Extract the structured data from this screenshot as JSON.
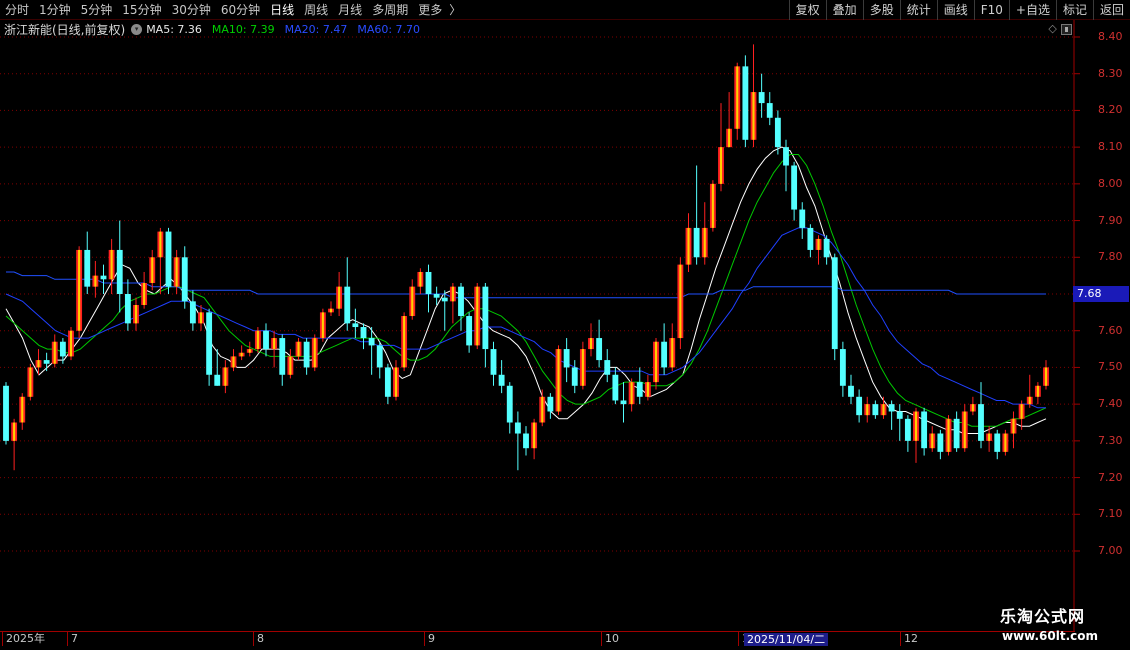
{
  "toolbar": {
    "periods": [
      "分时",
      "1分钟",
      "5分钟",
      "15分钟",
      "30分钟",
      "60分钟",
      "日线",
      "周线",
      "月线",
      "多周期",
      "更多"
    ],
    "more_arrow": "〉",
    "buttons": [
      "复权",
      "叠加",
      "多股",
      "统计",
      "画线",
      "F10",
      "+自选",
      "标记",
      "返回"
    ]
  },
  "info": {
    "stock_name": "浙江新能(日线,前复权)",
    "circle_glyph": "▾",
    "ma5": "MA5: 7.36",
    "ma10": "MA10: 7.39",
    "ma20": "MA20: 7.47",
    "ma60": "MA60: 7.70",
    "right_icons": [
      "◇",
      "⇔"
    ]
  },
  "price_axis": {
    "ticks": [
      "8.40",
      "8.30",
      "8.20",
      "8.10",
      "8.00",
      "7.90",
      "7.80",
      "7.70",
      "7.60",
      "7.50",
      "7.40",
      "7.30",
      "7.20",
      "7.10",
      "7.00"
    ],
    "cursor_price": "7.68"
  },
  "date_axis": {
    "ticks": [
      "2025年",
      "7",
      "8",
      "9",
      "10",
      "1",
      "12"
    ],
    "cursor_date": "2025/11/04/二"
  },
  "watermark": {
    "title": "乐淘公式网",
    "url": "www.60lt.com"
  },
  "colors": {
    "up_candle": "#ff2020",
    "up_candle_inner": "#ffd000",
    "down_candle": "#54ffff",
    "ma5": "#ffffff",
    "ma10": "#00c800",
    "ma20": "#2040ff",
    "ma60": "#2050ff",
    "grid": "#800000",
    "axis_text": "#d03030"
  },
  "chart_data": {
    "type": "candlestick",
    "y_range": [
      7.0,
      8.4
    ],
    "ohlc": [
      [
        7.45,
        7.3,
        7.46,
        7.29
      ],
      [
        7.3,
        7.35,
        7.36,
        7.22
      ],
      [
        7.35,
        7.42,
        7.43,
        7.33
      ],
      [
        7.42,
        7.5,
        7.51,
        7.41
      ],
      [
        7.5,
        7.52,
        7.55,
        7.48
      ],
      [
        7.52,
        7.51,
        7.54,
        7.49
      ],
      [
        7.51,
        7.57,
        7.59,
        7.5
      ],
      [
        7.57,
        7.53,
        7.58,
        7.51
      ],
      [
        7.53,
        7.6,
        7.61,
        7.52
      ],
      [
        7.6,
        7.82,
        7.83,
        7.58
      ],
      [
        7.82,
        7.72,
        7.87,
        7.7
      ],
      [
        7.72,
        7.75,
        7.79,
        7.69
      ],
      [
        7.75,
        7.74,
        7.78,
        7.7
      ],
      [
        7.74,
        7.82,
        7.85,
        7.7
      ],
      [
        7.82,
        7.7,
        7.9,
        7.65
      ],
      [
        7.7,
        7.62,
        7.74,
        7.6
      ],
      [
        7.62,
        7.67,
        7.69,
        7.6
      ],
      [
        7.67,
        7.73,
        7.76,
        7.66
      ],
      [
        7.73,
        7.8,
        7.82,
        7.71
      ],
      [
        7.8,
        7.87,
        7.88,
        7.7
      ],
      [
        7.87,
        7.72,
        7.88,
        7.7
      ],
      [
        7.72,
        7.8,
        7.82,
        7.7
      ],
      [
        7.8,
        7.68,
        7.83,
        7.66
      ],
      [
        7.68,
        7.62,
        7.71,
        7.6
      ],
      [
        7.62,
        7.65,
        7.67,
        7.6
      ],
      [
        7.65,
        7.48,
        7.66,
        7.45
      ],
      [
        7.48,
        7.45,
        7.55,
        7.45
      ],
      [
        7.45,
        7.5,
        7.52,
        7.43
      ],
      [
        7.5,
        7.53,
        7.55,
        7.49
      ],
      [
        7.53,
        7.54,
        7.56,
        7.52
      ],
      [
        7.54,
        7.55,
        7.57,
        7.53
      ],
      [
        7.55,
        7.6,
        7.61,
        7.54
      ],
      [
        7.6,
        7.55,
        7.62,
        7.53
      ],
      [
        7.55,
        7.58,
        7.6,
        7.5
      ],
      [
        7.58,
        7.48,
        7.59,
        7.45
      ],
      [
        7.48,
        7.53,
        7.55,
        7.47
      ],
      [
        7.53,
        7.57,
        7.58,
        7.52
      ],
      [
        7.57,
        7.5,
        7.58,
        7.48
      ],
      [
        7.5,
        7.58,
        7.59,
        7.49
      ],
      [
        7.58,
        7.65,
        7.66,
        7.57
      ],
      [
        7.65,
        7.66,
        7.68,
        7.64
      ],
      [
        7.66,
        7.72,
        7.76,
        7.64
      ],
      [
        7.72,
        7.62,
        7.8,
        7.6
      ],
      [
        7.62,
        7.61,
        7.66,
        7.58
      ],
      [
        7.61,
        7.58,
        7.62,
        7.55
      ],
      [
        7.58,
        7.56,
        7.61,
        7.48
      ],
      [
        7.56,
        7.5,
        7.57,
        7.47
      ],
      [
        7.5,
        7.42,
        7.51,
        7.4
      ],
      [
        7.42,
        7.5,
        7.52,
        7.41
      ],
      [
        7.5,
        7.64,
        7.65,
        7.49
      ],
      [
        7.64,
        7.72,
        7.74,
        7.63
      ],
      [
        7.72,
        7.76,
        7.77,
        7.7
      ],
      [
        7.76,
        7.7,
        7.78,
        7.65
      ],
      [
        7.7,
        7.69,
        7.72,
        7.67
      ],
      [
        7.69,
        7.68,
        7.71,
        7.6
      ],
      [
        7.68,
        7.72,
        7.73,
        7.62
      ],
      [
        7.72,
        7.64,
        7.73,
        7.6
      ],
      [
        7.64,
        7.56,
        7.65,
        7.54
      ],
      [
        7.56,
        7.72,
        7.73,
        7.55
      ],
      [
        7.72,
        7.55,
        7.73,
        7.5
      ],
      [
        7.55,
        7.48,
        7.57,
        7.45
      ],
      [
        7.48,
        7.45,
        7.52,
        7.43
      ],
      [
        7.45,
        7.35,
        7.46,
        7.32
      ],
      [
        7.35,
        7.32,
        7.38,
        7.22
      ],
      [
        7.32,
        7.28,
        7.34,
        7.26
      ],
      [
        7.28,
        7.35,
        7.36,
        7.25
      ],
      [
        7.35,
        7.42,
        7.44,
        7.34
      ],
      [
        7.42,
        7.38,
        7.43,
        7.36
      ],
      [
        7.38,
        7.55,
        7.56,
        7.37
      ],
      [
        7.55,
        7.5,
        7.58,
        7.46
      ],
      [
        7.5,
        7.45,
        7.52,
        7.43
      ],
      [
        7.45,
        7.55,
        7.57,
        7.44
      ],
      [
        7.55,
        7.58,
        7.62,
        7.53
      ],
      [
        7.58,
        7.52,
        7.63,
        7.5
      ],
      [
        7.52,
        7.48,
        7.55,
        7.46
      ],
      [
        7.48,
        7.41,
        7.5,
        7.4
      ],
      [
        7.41,
        7.4,
        7.46,
        7.35
      ],
      [
        7.4,
        7.46,
        7.47,
        7.38
      ],
      [
        7.46,
        7.42,
        7.5,
        7.4
      ],
      [
        7.42,
        7.46,
        7.48,
        7.41
      ],
      [
        7.46,
        7.57,
        7.58,
        7.44
      ],
      [
        7.57,
        7.5,
        7.62,
        7.48
      ],
      [
        7.5,
        7.58,
        7.62,
        7.49
      ],
      [
        7.58,
        7.78,
        7.8,
        7.55
      ],
      [
        7.78,
        7.88,
        7.92,
        7.76
      ],
      [
        7.88,
        7.8,
        8.05,
        7.78
      ],
      [
        7.8,
        7.88,
        7.95,
        7.78
      ],
      [
        7.88,
        8.0,
        8.01,
        7.87
      ],
      [
        8.0,
        8.1,
        8.22,
        7.98
      ],
      [
        8.1,
        8.15,
        8.25,
        8.12
      ],
      [
        8.15,
        8.32,
        8.33,
        8.12
      ],
      [
        8.32,
        8.12,
        8.35,
        8.1
      ],
      [
        8.12,
        8.25,
        8.38,
        8.1
      ],
      [
        8.25,
        8.22,
        8.3,
        8.18
      ],
      [
        8.22,
        8.18,
        8.25,
        8.16
      ],
      [
        8.18,
        8.1,
        8.2,
        8.08
      ],
      [
        8.1,
        8.05,
        8.12,
        7.98
      ],
      [
        8.05,
        7.93,
        8.06,
        7.9
      ],
      [
        7.93,
        7.88,
        7.95,
        7.85
      ],
      [
        7.88,
        7.82,
        7.89,
        7.8
      ],
      [
        7.82,
        7.85,
        7.86,
        7.78
      ],
      [
        7.85,
        7.8,
        7.86,
        7.78
      ],
      [
        7.8,
        7.55,
        7.81,
        7.52
      ],
      [
        7.55,
        7.45,
        7.57,
        7.42
      ],
      [
        7.45,
        7.42,
        7.48,
        7.4
      ],
      [
        7.42,
        7.37,
        7.44,
        7.35
      ],
      [
        7.37,
        7.4,
        7.42,
        7.35
      ],
      [
        7.4,
        7.37,
        7.41,
        7.36
      ],
      [
        7.37,
        7.4,
        7.42,
        7.36
      ],
      [
        7.4,
        7.38,
        7.41,
        7.33
      ],
      [
        7.38,
        7.36,
        7.4,
        7.3
      ],
      [
        7.36,
        7.3,
        7.37,
        7.27
      ],
      [
        7.3,
        7.38,
        7.39,
        7.24
      ],
      [
        7.38,
        7.28,
        7.39,
        7.26
      ],
      [
        7.28,
        7.32,
        7.34,
        7.27
      ],
      [
        7.32,
        7.27,
        7.33,
        7.25
      ],
      [
        7.27,
        7.36,
        7.37,
        7.26
      ],
      [
        7.36,
        7.28,
        7.38,
        7.27
      ],
      [
        7.28,
        7.38,
        7.4,
        7.27
      ],
      [
        7.38,
        7.4,
        7.42,
        7.37
      ],
      [
        7.4,
        7.3,
        7.46,
        7.28
      ],
      [
        7.3,
        7.32,
        7.34,
        7.27
      ],
      [
        7.32,
        7.27,
        7.33,
        7.25
      ],
      [
        7.27,
        7.32,
        7.33,
        7.26
      ],
      [
        7.32,
        7.36,
        7.38,
        7.28
      ],
      [
        7.36,
        7.4,
        7.41,
        7.33
      ],
      [
        7.4,
        7.42,
        7.48,
        7.39
      ],
      [
        7.42,
        7.45,
        7.46,
        7.4
      ],
      [
        7.45,
        7.5,
        7.52,
        7.44
      ]
    ],
    "ma_lines": {
      "MA5": [
        7.66,
        7.62,
        7.58,
        7.52,
        7.48,
        7.5,
        7.52,
        7.52,
        7.55,
        7.58,
        7.62,
        7.66,
        7.7,
        7.74,
        7.78,
        7.77,
        7.73,
        7.71,
        7.7,
        7.72,
        7.74,
        7.72,
        7.69,
        7.66,
        7.62,
        7.56,
        7.53,
        7.52,
        7.5,
        7.5,
        7.52,
        7.55,
        7.55,
        7.55,
        7.54,
        7.52,
        7.52,
        7.52,
        7.54,
        7.58,
        7.6,
        7.62,
        7.63,
        7.62,
        7.61,
        7.58,
        7.54,
        7.49,
        7.47,
        7.48,
        7.54,
        7.6,
        7.66,
        7.7,
        7.71,
        7.7,
        7.68,
        7.65,
        7.62,
        7.6,
        7.59,
        7.58,
        7.56,
        7.53,
        7.48,
        7.42,
        7.38,
        7.36,
        7.36,
        7.38,
        7.4,
        7.43,
        7.47,
        7.5,
        7.5,
        7.48,
        7.45,
        7.44,
        7.42,
        7.43,
        7.44,
        7.46,
        7.48,
        7.55,
        7.63,
        7.7,
        7.77,
        7.83,
        7.89,
        7.95,
        8.0,
        8.04,
        8.07,
        8.09,
        8.1,
        8.09,
        8.05,
        7.99,
        7.94,
        7.87,
        7.8,
        7.73,
        7.65,
        7.58,
        7.52,
        7.46,
        7.42,
        7.39,
        7.38,
        7.38,
        7.37,
        7.36,
        7.35,
        7.34,
        7.33,
        7.33,
        7.32,
        7.32,
        7.32,
        7.33,
        7.34,
        7.35,
        7.35,
        7.34,
        7.34,
        7.35,
        7.36
      ],
      "MA10": [
        7.64,
        7.62,
        7.6,
        7.58,
        7.56,
        7.55,
        7.55,
        7.54,
        7.54,
        7.55,
        7.57,
        7.59,
        7.61,
        7.63,
        7.66,
        7.68,
        7.69,
        7.7,
        7.7,
        7.71,
        7.72,
        7.72,
        7.71,
        7.7,
        7.69,
        7.66,
        7.63,
        7.6,
        7.58,
        7.56,
        7.55,
        7.54,
        7.53,
        7.53,
        7.53,
        7.53,
        7.53,
        7.53,
        7.54,
        7.55,
        7.56,
        7.57,
        7.58,
        7.58,
        7.58,
        7.58,
        7.57,
        7.55,
        7.53,
        7.52,
        7.52,
        7.53,
        7.55,
        7.58,
        7.61,
        7.63,
        7.65,
        7.66,
        7.66,
        7.65,
        7.64,
        7.62,
        7.6,
        7.57,
        7.53,
        7.49,
        7.46,
        7.43,
        7.41,
        7.4,
        7.4,
        7.41,
        7.42,
        7.44,
        7.45,
        7.46,
        7.46,
        7.46,
        7.45,
        7.45,
        7.45,
        7.46,
        7.48,
        7.51,
        7.55,
        7.6,
        7.66,
        7.72,
        7.78,
        7.84,
        7.9,
        7.95,
        7.99,
        8.03,
        8.06,
        8.08,
        8.08,
        8.05,
        8.0,
        7.94,
        7.87,
        7.81,
        7.74,
        7.67,
        7.61,
        7.55,
        7.5,
        7.46,
        7.43,
        7.41,
        7.4,
        7.39,
        7.38,
        7.37,
        7.36,
        7.35,
        7.35,
        7.34,
        7.34,
        7.34,
        7.34,
        7.35,
        7.36,
        7.36,
        7.37,
        7.38,
        7.39
      ],
      "MA20": [
        7.7,
        7.69,
        7.68,
        7.66,
        7.64,
        7.62,
        7.6,
        7.59,
        7.58,
        7.58,
        7.58,
        7.59,
        7.6,
        7.61,
        7.62,
        7.63,
        7.64,
        7.65,
        7.66,
        7.67,
        7.68,
        7.68,
        7.68,
        7.67,
        7.66,
        7.65,
        7.64,
        7.63,
        7.62,
        7.61,
        7.6,
        7.6,
        7.6,
        7.59,
        7.59,
        7.59,
        7.58,
        7.58,
        7.58,
        7.58,
        7.58,
        7.58,
        7.58,
        7.57,
        7.57,
        7.56,
        7.56,
        7.56,
        7.55,
        7.55,
        7.55,
        7.55,
        7.56,
        7.57,
        7.58,
        7.59,
        7.6,
        7.6,
        7.61,
        7.61,
        7.61,
        7.6,
        7.59,
        7.58,
        7.57,
        7.55,
        7.54,
        7.52,
        7.51,
        7.5,
        7.49,
        7.49,
        7.49,
        7.49,
        7.49,
        7.49,
        7.49,
        7.49,
        7.48,
        7.48,
        7.48,
        7.49,
        7.5,
        7.52,
        7.54,
        7.57,
        7.6,
        7.63,
        7.66,
        7.7,
        7.73,
        7.77,
        7.8,
        7.83,
        7.86,
        7.87,
        7.88,
        7.88,
        7.87,
        7.86,
        7.84,
        7.81,
        7.78,
        7.74,
        7.71,
        7.67,
        7.64,
        7.6,
        7.57,
        7.55,
        7.53,
        7.51,
        7.5,
        7.48,
        7.47,
        7.46,
        7.45,
        7.44,
        7.43,
        7.42,
        7.41,
        7.41,
        7.4,
        7.4,
        7.4,
        7.39,
        7.39
      ],
      "MA60": [
        7.76,
        7.76,
        7.75,
        7.75,
        7.75,
        7.75,
        7.74,
        7.74,
        7.74,
        7.74,
        7.74,
        7.74,
        7.73,
        7.73,
        7.73,
        7.73,
        7.73,
        7.73,
        7.72,
        7.72,
        7.72,
        7.72,
        7.71,
        7.71,
        7.71,
        7.71,
        7.71,
        7.71,
        7.71,
        7.71,
        7.71,
        7.7,
        7.7,
        7.7,
        7.7,
        7.7,
        7.7,
        7.7,
        7.7,
        7.7,
        7.7,
        7.7,
        7.7,
        7.7,
        7.7,
        7.7,
        7.7,
        7.7,
        7.7,
        7.7,
        7.7,
        7.7,
        7.7,
        7.7,
        7.7,
        7.69,
        7.69,
        7.69,
        7.69,
        7.69,
        7.69,
        7.69,
        7.69,
        7.69,
        7.69,
        7.69,
        7.69,
        7.69,
        7.69,
        7.69,
        7.69,
        7.69,
        7.69,
        7.69,
        7.69,
        7.69,
        7.69,
        7.69,
        7.69,
        7.69,
        7.69,
        7.69,
        7.69,
        7.69,
        7.7,
        7.7,
        7.7,
        7.7,
        7.71,
        7.71,
        7.71,
        7.71,
        7.72,
        7.72,
        7.72,
        7.72,
        7.72,
        7.72,
        7.72,
        7.72,
        7.72,
        7.72,
        7.72,
        7.71,
        7.71,
        7.71,
        7.71,
        7.71,
        7.71,
        7.71,
        7.71,
        7.71,
        7.71,
        7.71,
        7.71,
        7.71,
        7.71,
        7.7,
        7.7,
        7.7,
        7.7,
        7.7,
        7.7,
        7.7,
        7.7,
        7.7,
        7.7,
        7.7,
        7.7
      ]
    }
  }
}
